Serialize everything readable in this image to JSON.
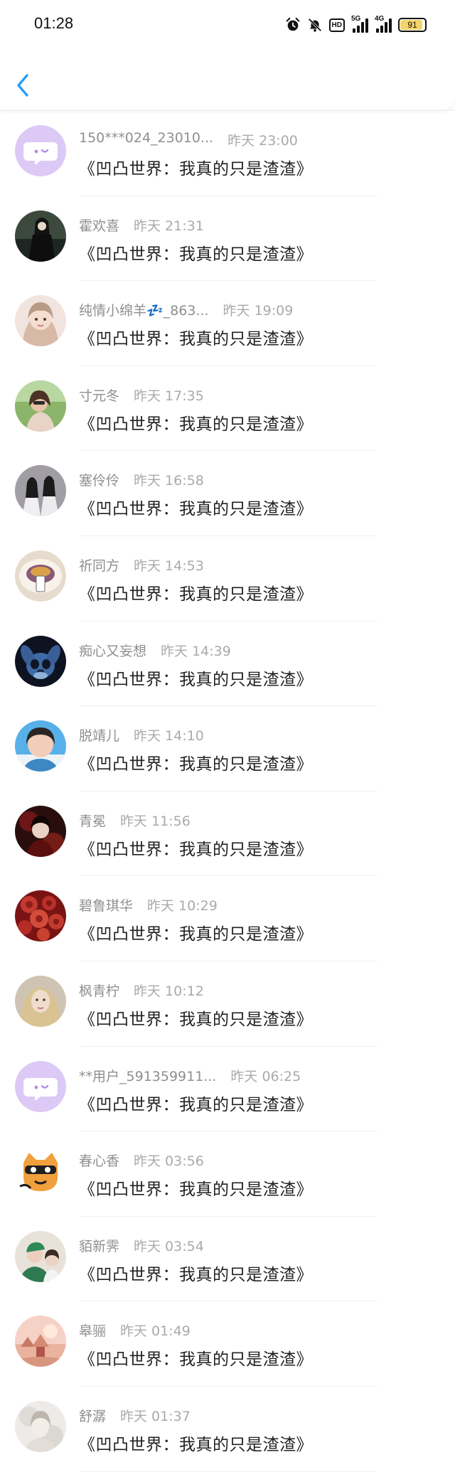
{
  "status_bar": {
    "time": "01:28",
    "hd_label": "HD",
    "signal_5g": "5G",
    "signal_4g": "4G",
    "battery_level": "91",
    "icons": [
      "alarm-icon",
      "mute-icon",
      "hd-icon",
      "signal-5g-icon",
      "signal-4g-icon",
      "battery-icon"
    ]
  },
  "nav": {
    "back_icon": "chevron-left-icon",
    "accent_color": "#2a9df4"
  },
  "items": [
    {
      "name": "150***024_23010...",
      "time": "昨天 23:00",
      "message": "《凹凸世界：我真的只是渣渣》",
      "avatar": "default-chat-bubble"
    },
    {
      "name": "霍欢喜",
      "time": "昨天 21:31",
      "message": "《凹凸世界：我真的只是渣渣》",
      "avatar": "dark-figure"
    },
    {
      "name": "纯情小绵羊💤_863...",
      "time": "昨天 19:09",
      "message": "《凹凸世界：我真的只是渣渣》",
      "avatar": "girl-light"
    },
    {
      "name": "寸元冬",
      "time": "昨天 17:35",
      "message": "《凹凸世界：我真的只是渣渣》",
      "avatar": "girl-outdoor"
    },
    {
      "name": "塞伶伶",
      "time": "昨天 16:58",
      "message": "《凹凸世界：我真的只是渣渣》",
      "avatar": "white-robes"
    },
    {
      "name": "祈同方",
      "time": "昨天 14:53",
      "message": "《凹凸世界：我真的只是渣渣》",
      "avatar": "plate-photo"
    },
    {
      "name": "痴心又妄想",
      "time": "昨天 14:39",
      "message": "《凹凸世界：我真的只是渣渣》",
      "avatar": "stitch"
    },
    {
      "name": "脱靖儿",
      "time": "昨天 14:10",
      "message": "《凹凸世界：我真的只是渣渣》",
      "avatar": "person-sky"
    },
    {
      "name": "青冕",
      "time": "昨天 11:56",
      "message": "《凹凸世界：我真的只是渣渣》",
      "avatar": "red-dark"
    },
    {
      "name": "碧鲁琪华",
      "time": "昨天 10:29",
      "message": "《凹凸世界：我真的只是渣渣》",
      "avatar": "red-cells"
    },
    {
      "name": "枫青柠",
      "time": "昨天 10:12",
      "message": "《凹凸世界：我真的只是渣渣》",
      "avatar": "blonde-girl"
    },
    {
      "name": "**用户_591359911...",
      "time": "昨天 06:25",
      "message": "《凹凸世界：我真的只是渣渣》",
      "avatar": "default-chat-bubble"
    },
    {
      "name": "春心香",
      "time": "昨天 03:56",
      "message": "《凹凸世界：我真的只是渣渣》",
      "avatar": "cartoon-cat"
    },
    {
      "name": "貊新霁",
      "time": "昨天 03:54",
      "message": "《凹凸世界：我真的只是渣渣》",
      "avatar": "green-cap"
    },
    {
      "name": "皋骊",
      "time": "昨天 01:49",
      "message": "《凹凸世界：我真的只是渣渣》",
      "avatar": "pink-scene"
    },
    {
      "name": "舒潺",
      "time": "昨天 01:37",
      "message": "《凹凸世界：我真的只是渣渣》",
      "avatar": "pale-art"
    }
  ]
}
